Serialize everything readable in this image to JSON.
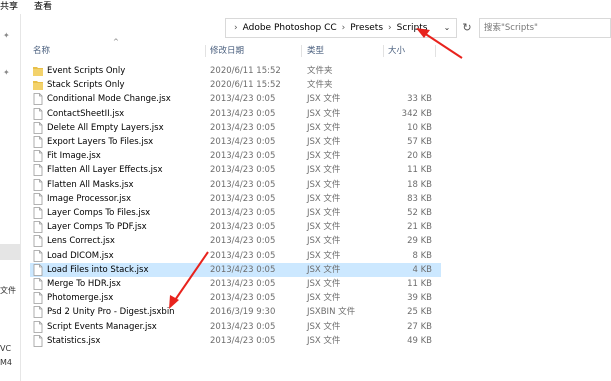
{
  "menu": {
    "share": "共享",
    "view": "查看"
  },
  "breadcrumb": {
    "items": [
      "Adobe Photoshop CC",
      "Presets",
      "Scripts"
    ],
    "separator": "›"
  },
  "search": {
    "placeholder": "搜索\"Scripts\""
  },
  "columns": {
    "name": "名称",
    "date": "修改日期",
    "type": "类型",
    "size": "大小"
  },
  "sidebar_fragments": [
    "VC",
    "M4",
    "文件"
  ],
  "colors": {
    "folder": "#e8c04a",
    "selected": "#cce8ff",
    "arrow": "#e8231d"
  },
  "files": [
    {
      "name": "Event Scripts Only",
      "date": "2020/6/11 15:52",
      "type": "文件夹",
      "size": "",
      "kind": "folder"
    },
    {
      "name": "Stack Scripts Only",
      "date": "2020/6/11 15:52",
      "type": "文件夹",
      "size": "",
      "kind": "folder"
    },
    {
      "name": "Conditional Mode Change.jsx",
      "date": "2013/4/23 0:05",
      "type": "JSX 文件",
      "size": "33 KB",
      "kind": "file"
    },
    {
      "name": "ContactSheetII.jsx",
      "date": "2013/4/23 0:05",
      "type": "JSX 文件",
      "size": "342 KB",
      "kind": "file"
    },
    {
      "name": "Delete All Empty Layers.jsx",
      "date": "2013/4/23 0:05",
      "type": "JSX 文件",
      "size": "10 KB",
      "kind": "file"
    },
    {
      "name": "Export Layers To Files.jsx",
      "date": "2013/4/23 0:05",
      "type": "JSX 文件",
      "size": "57 KB",
      "kind": "file"
    },
    {
      "name": "Fit Image.jsx",
      "date": "2013/4/23 0:05",
      "type": "JSX 文件",
      "size": "20 KB",
      "kind": "file"
    },
    {
      "name": "Flatten All Layer Effects.jsx",
      "date": "2013/4/23 0:05",
      "type": "JSX 文件",
      "size": "11 KB",
      "kind": "file"
    },
    {
      "name": "Flatten All Masks.jsx",
      "date": "2013/4/23 0:05",
      "type": "JSX 文件",
      "size": "18 KB",
      "kind": "file"
    },
    {
      "name": "Image Processor.jsx",
      "date": "2013/4/23 0:05",
      "type": "JSX 文件",
      "size": "83 KB",
      "kind": "file"
    },
    {
      "name": "Layer Comps To Files.jsx",
      "date": "2013/4/23 0:05",
      "type": "JSX 文件",
      "size": "52 KB",
      "kind": "file"
    },
    {
      "name": "Layer Comps To PDF.jsx",
      "date": "2013/4/23 0:05",
      "type": "JSX 文件",
      "size": "21 KB",
      "kind": "file"
    },
    {
      "name": "Lens Correct.jsx",
      "date": "2013/4/23 0:05",
      "type": "JSX 文件",
      "size": "29 KB",
      "kind": "file"
    },
    {
      "name": "Load DICOM.jsx",
      "date": "2013/4/23 0:05",
      "type": "JSX 文件",
      "size": "8 KB",
      "kind": "file"
    },
    {
      "name": "Load Files into Stack.jsx",
      "date": "2013/4/23 0:05",
      "type": "JSX 文件",
      "size": "4 KB",
      "kind": "file",
      "selected": true
    },
    {
      "name": "Merge To HDR.jsx",
      "date": "2013/4/23 0:05",
      "type": "JSX 文件",
      "size": "11 KB",
      "kind": "file"
    },
    {
      "name": "Photomerge.jsx",
      "date": "2013/4/23 0:05",
      "type": "JSX 文件",
      "size": "39 KB",
      "kind": "file"
    },
    {
      "name": "Psd 2 Unity Pro - Digest.jsxbin",
      "date": "2016/3/19 9:30",
      "type": "JSXBIN 文件",
      "size": "25 KB",
      "kind": "file"
    },
    {
      "name": "Script Events Manager.jsx",
      "date": "2013/4/23 0:05",
      "type": "JSX 文件",
      "size": "27 KB",
      "kind": "file"
    },
    {
      "name": "Statistics.jsx",
      "date": "2013/4/23 0:05",
      "type": "JSX 文件",
      "size": "49 KB",
      "kind": "file"
    }
  ]
}
